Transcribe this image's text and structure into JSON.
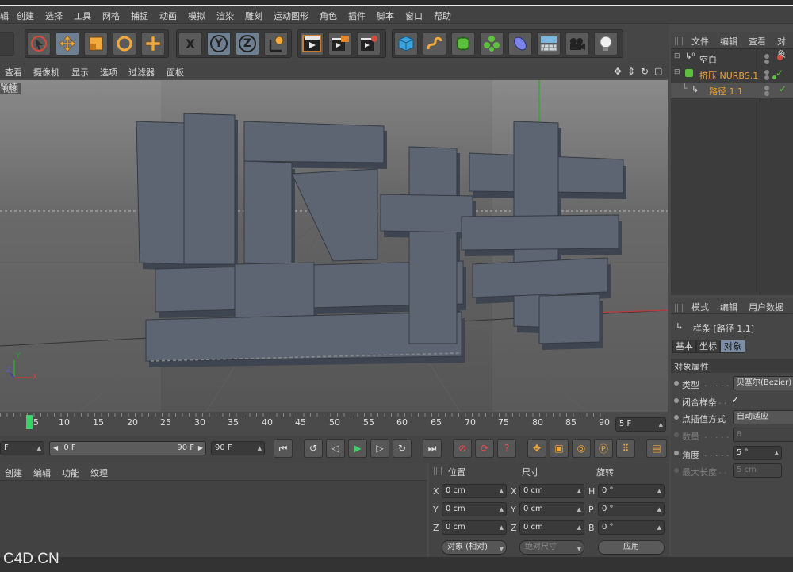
{
  "menu": [
    "辑",
    "创建",
    "选择",
    "工具",
    "网格",
    "捕捉",
    "动画",
    "模拟",
    "渲染",
    "雕刻",
    "运动图形",
    "角色",
    "插件",
    "脚本",
    "窗口",
    "帮助"
  ],
  "toolbar": {
    "x_label": "X",
    "y_label": "Y",
    "z_label": "Z"
  },
  "viewport_menu": [
    "查看",
    "摄像机",
    "显示",
    "选项",
    "过滤器",
    "面板"
  ],
  "viewport": {
    "label": "视图",
    "text3d": "坚持",
    "axis_y": "Y",
    "axis_z": "Z",
    "axis_x": "X"
  },
  "timeline": {
    "ticks": [
      "5",
      "10",
      "15",
      "20",
      "25",
      "30",
      "35",
      "40",
      "45",
      "50",
      "55",
      "60",
      "65",
      "70",
      "75",
      "80",
      "85",
      "90"
    ],
    "current_frame_field": "5 F"
  },
  "playbar": {
    "start_field": "F",
    "range_start": "0 F",
    "range_end": "90 F",
    "end_field": "90 F"
  },
  "material_menu": [
    "创建",
    "编辑",
    "功能",
    "纹理"
  ],
  "coords": {
    "headers": [
      "位置",
      "尺寸",
      "旋转"
    ],
    "rows": [
      {
        "a": "X",
        "pos": "0 cm",
        "b": "X",
        "size": "0 cm",
        "c": "H",
        "rot": "0 °"
      },
      {
        "a": "Y",
        "pos": "0 cm",
        "b": "Y",
        "size": "0 cm",
        "c": "P",
        "rot": "0 °"
      },
      {
        "a": "Z",
        "pos": "0 cm",
        "b": "Z",
        "size": "0 cm",
        "c": "B",
        "rot": "0 °"
      }
    ],
    "mode_select": "对象 (相对)",
    "size_select": "绝对尺寸",
    "apply_label": "应用"
  },
  "object_manager": {
    "menu": [
      "文件",
      "编辑",
      "查看",
      "对象"
    ],
    "items": [
      {
        "label": "空白",
        "color": "#dcdcdc"
      },
      {
        "label": "挤压 NURBS.1",
        "color": "#e9a23c"
      },
      {
        "label": "路径 1.1",
        "color": "#f0a028"
      }
    ]
  },
  "attribute_manager": {
    "menu": [
      "模式",
      "编辑",
      "用户数据"
    ],
    "title": "样条 [路径 1.1]",
    "tabs": [
      "基本",
      "坐标",
      "对象"
    ],
    "section": "对象属性",
    "props": [
      {
        "label": "类型",
        "dots": ". . . . .",
        "value": "贝塞尔(Bezier)",
        "enabled": true
      },
      {
        "label": "闭合样条",
        "dots": ". .",
        "value": "✓",
        "enabled": true
      },
      {
        "label": "点插值方式",
        "dots": "",
        "value": "自动适应",
        "enabled": true
      },
      {
        "label": "数量",
        "dots": ". . . . .",
        "value": "8",
        "enabled": false
      },
      {
        "label": "角度",
        "dots": ". . . . .",
        "value": "5 °",
        "enabled": true
      },
      {
        "label": "最大长度",
        "dots": ". .",
        "value": "5 cm",
        "enabled": false
      }
    ]
  },
  "watermark": "C4D.CN"
}
